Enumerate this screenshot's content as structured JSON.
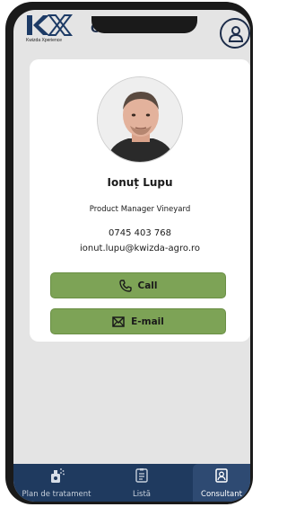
{
  "header": {
    "logo_text": "KX",
    "logo_subtitle": "Kwizda Xperience",
    "title": "Consultant",
    "profile_icon": "user-icon"
  },
  "consultant": {
    "name": "Ionuț Lupu",
    "role": "Product Manager Vineyard",
    "phone": "0745 403 768",
    "email": "ionut.lupu@kwizda-agro.ro"
  },
  "actions": {
    "call_label": "Call",
    "call_icon": "phone-icon",
    "email_label": "E-mail",
    "email_icon": "envelope-icon"
  },
  "bottom_nav": {
    "items": [
      {
        "label": "Plan de tratament",
        "icon": "sprayer-icon",
        "active": false
      },
      {
        "label": "Listă",
        "icon": "list-icon",
        "active": false
      },
      {
        "label": "Consultant",
        "icon": "contact-card-icon",
        "active": true
      }
    ]
  },
  "colors": {
    "accent_green": "#7da356",
    "navy": "#1f3a5f",
    "background": "#e4e4e4",
    "card": "#ffffff"
  }
}
